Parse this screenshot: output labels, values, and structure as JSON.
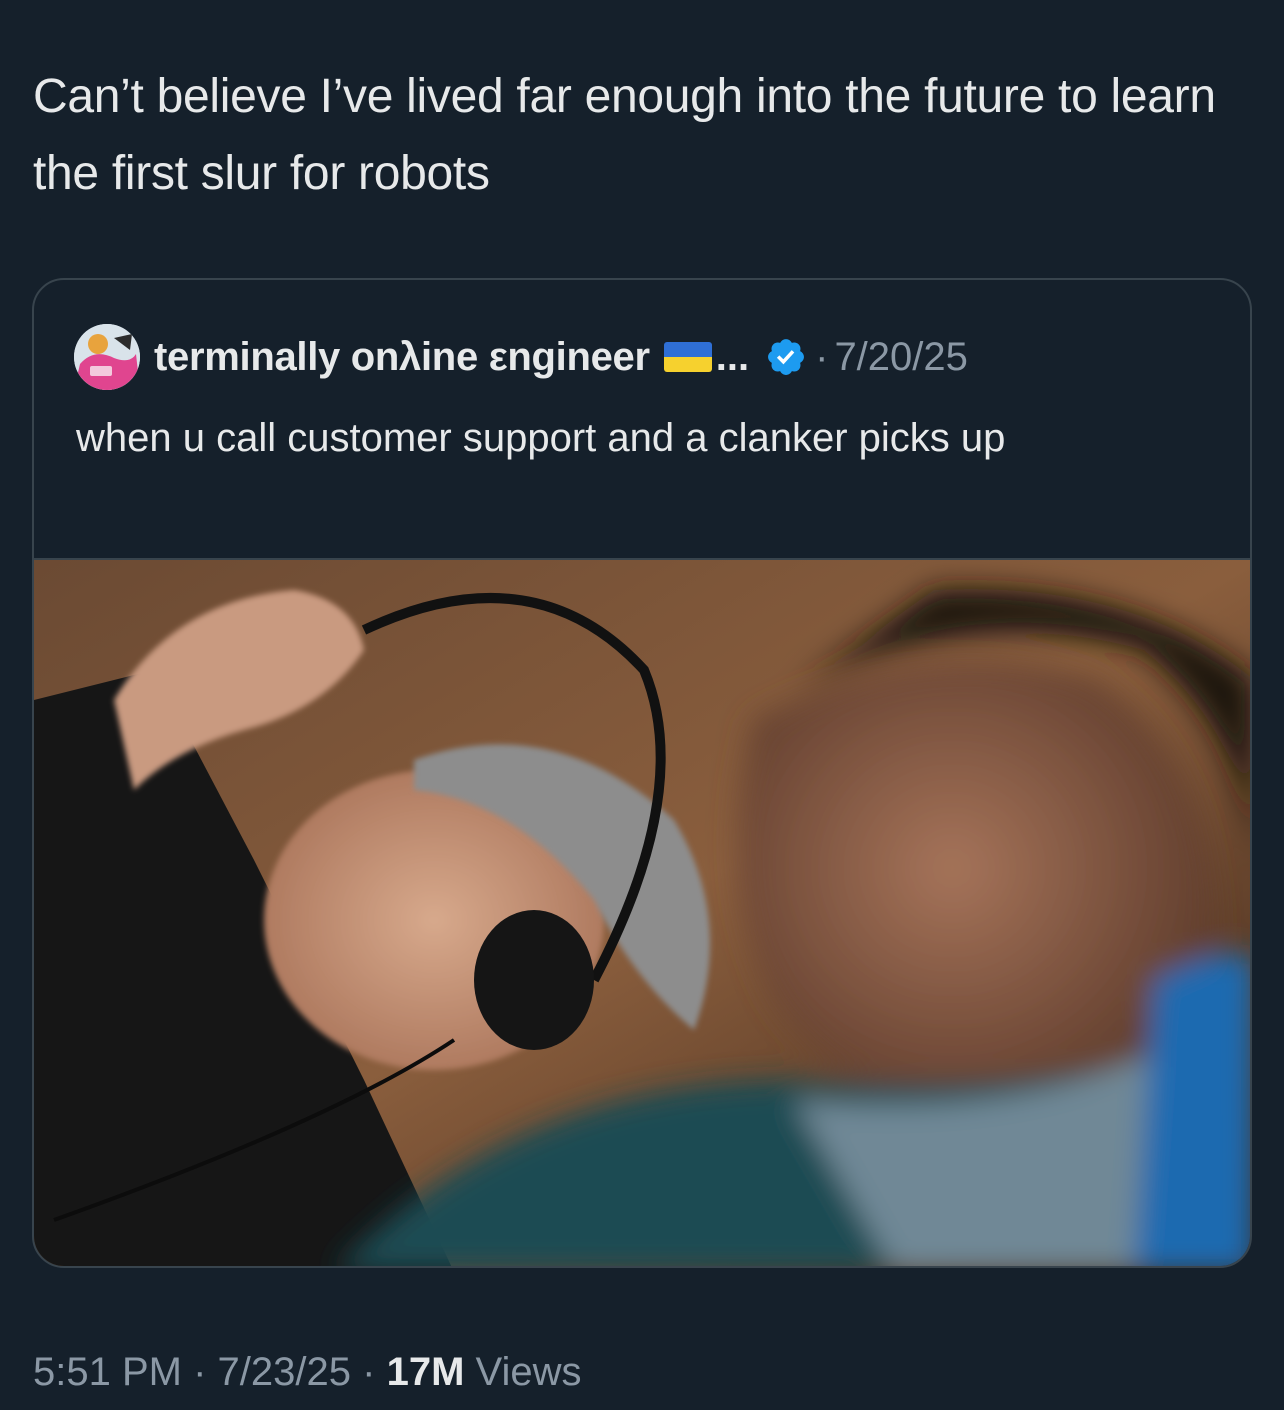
{
  "tweet": {
    "text": "Can’t believe I’ve lived far enough into the future to learn the first slur for robots",
    "time": "5:51 PM",
    "separator": "·",
    "date": "7/23/25",
    "views_count": "17M",
    "views_label": "Views"
  },
  "quoted_tweet": {
    "author_name": "terminally onλine εngineer",
    "truncation": "...",
    "separator": "·",
    "date": "7/20/25",
    "text": "when u call customer support and a clanker picks up",
    "avatar_icon": "avatar-icon",
    "flag_icon": "ukraine-flag-icon",
    "verified_icon": "verified-badge-icon"
  },
  "colors": {
    "background": "#15202b",
    "text": "#e7e9ea",
    "muted": "#8b98a5",
    "border": "#38444d",
    "verified": "#1d9bf0"
  }
}
